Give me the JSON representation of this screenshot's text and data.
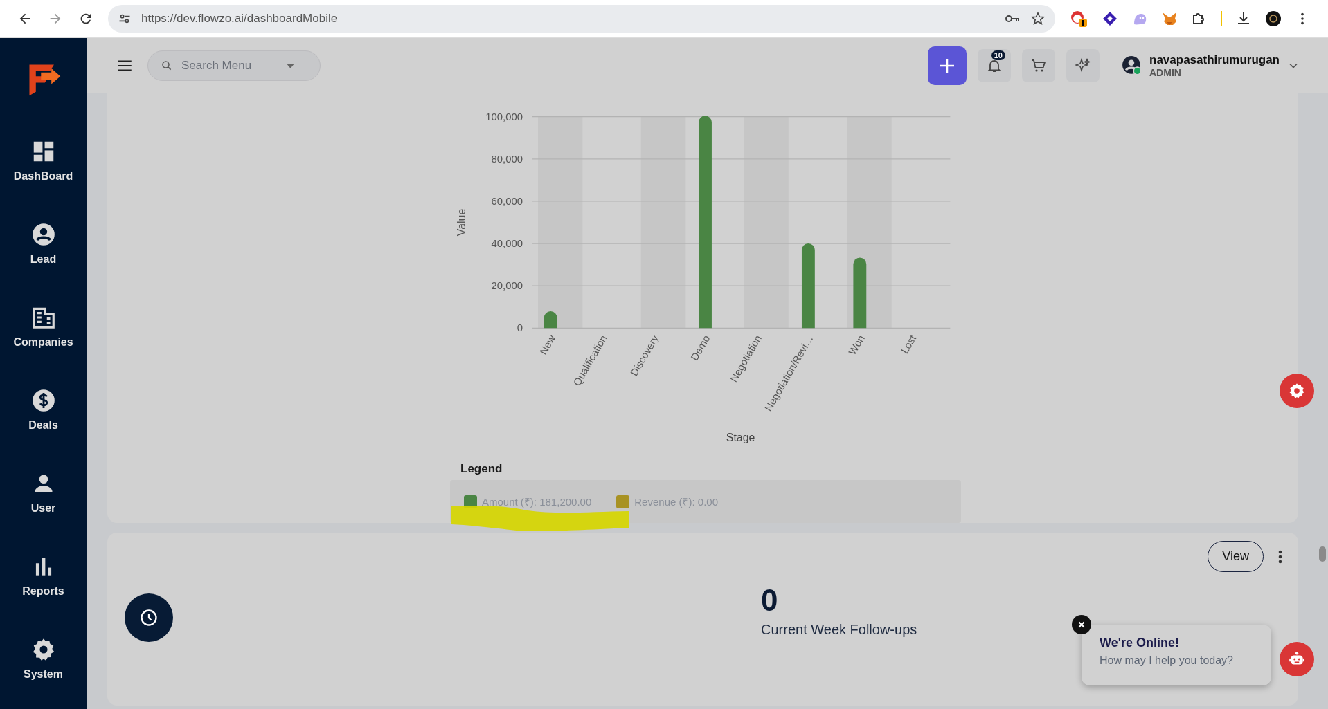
{
  "browser": {
    "url": "https://dev.flowzo.ai/dashboardMobile"
  },
  "sidebar": {
    "items": [
      {
        "label": "DashBoard"
      },
      {
        "label": "Lead"
      },
      {
        "label": "Companies"
      },
      {
        "label": "Deals"
      },
      {
        "label": "User"
      },
      {
        "label": "Reports"
      },
      {
        "label": "System"
      }
    ]
  },
  "header": {
    "search": {
      "placeholder": "Search Menu"
    },
    "notifications_badge": "10",
    "user": {
      "name": "navapasathirumurugan",
      "role": "ADMIN"
    }
  },
  "pipeline_card": {
    "chart_data": {
      "type": "bar",
      "xlabel": "Stage",
      "ylabel": "Value",
      "categories": [
        "New",
        "Qualification",
        "Discovery",
        "Demo",
        "Negotiation",
        "Negotiation/Revi…",
        "Won",
        "Lost"
      ],
      "series": [
        {
          "name": "Amount (₹)",
          "color": "#4a8544",
          "values": [
            7500,
            0,
            0,
            100000,
            0,
            39500,
            32800,
            0
          ]
        },
        {
          "name": "Revenue (₹)",
          "color": "#a89223",
          "values": [
            0,
            0,
            0,
            0,
            0,
            0,
            0,
            0
          ]
        }
      ],
      "ylim": [
        0,
        100000
      ],
      "grid": true,
      "yticks": [
        {
          "value": 0,
          "label": "0"
        },
        {
          "value": 20000,
          "label": "20,000"
        },
        {
          "value": 40000,
          "label": "40,000"
        },
        {
          "value": 60000,
          "label": "60,000"
        },
        {
          "value": 80000,
          "label": "80,000"
        },
        {
          "value": 100000,
          "label": "100,000"
        }
      ]
    },
    "legend": {
      "title": "Legend",
      "items": [
        {
          "value": ": 181,200.00"
        },
        {
          "value": ": 0.00"
        }
      ]
    }
  },
  "followup_card": {
    "button": "View",
    "count": "0",
    "label": "Current Week Follow-ups"
  },
  "chat": {
    "title": "We're Online!",
    "message": "How may I help you today?"
  }
}
